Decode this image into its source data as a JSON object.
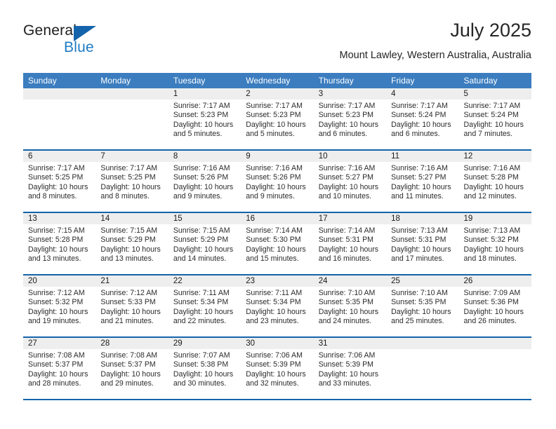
{
  "brand": {
    "name_part1": "General",
    "name_part2": "Blue",
    "logo_icon": "triangle-flag-icon"
  },
  "header": {
    "month_title": "July 2025",
    "location": "Mount Lawley, Western Australia, Australia"
  },
  "colors": {
    "header_blue": "#3b7dbf",
    "rule_blue": "#1464ab",
    "brand_blue": "#1f7bc4",
    "daynum_band": "#eeeeee"
  },
  "weekdays": [
    "Sunday",
    "Monday",
    "Tuesday",
    "Wednesday",
    "Thursday",
    "Friday",
    "Saturday"
  ],
  "weeks": [
    [
      {
        "day": "",
        "sunrise": "",
        "sunset": "",
        "daylight": "",
        "empty": true
      },
      {
        "day": "",
        "sunrise": "",
        "sunset": "",
        "daylight": "",
        "empty": true
      },
      {
        "day": "1",
        "sunrise": "Sunrise: 7:17 AM",
        "sunset": "Sunset: 5:23 PM",
        "daylight": "Daylight: 10 hours and 5 minutes."
      },
      {
        "day": "2",
        "sunrise": "Sunrise: 7:17 AM",
        "sunset": "Sunset: 5:23 PM",
        "daylight": "Daylight: 10 hours and 5 minutes."
      },
      {
        "day": "3",
        "sunrise": "Sunrise: 7:17 AM",
        "sunset": "Sunset: 5:23 PM",
        "daylight": "Daylight: 10 hours and 6 minutes."
      },
      {
        "day": "4",
        "sunrise": "Sunrise: 7:17 AM",
        "sunset": "Sunset: 5:24 PM",
        "daylight": "Daylight: 10 hours and 6 minutes."
      },
      {
        "day": "5",
        "sunrise": "Sunrise: 7:17 AM",
        "sunset": "Sunset: 5:24 PM",
        "daylight": "Daylight: 10 hours and 7 minutes."
      }
    ],
    [
      {
        "day": "6",
        "sunrise": "Sunrise: 7:17 AM",
        "sunset": "Sunset: 5:25 PM",
        "daylight": "Daylight: 10 hours and 8 minutes."
      },
      {
        "day": "7",
        "sunrise": "Sunrise: 7:17 AM",
        "sunset": "Sunset: 5:25 PM",
        "daylight": "Daylight: 10 hours and 8 minutes."
      },
      {
        "day": "8",
        "sunrise": "Sunrise: 7:16 AM",
        "sunset": "Sunset: 5:26 PM",
        "daylight": "Daylight: 10 hours and 9 minutes."
      },
      {
        "day": "9",
        "sunrise": "Sunrise: 7:16 AM",
        "sunset": "Sunset: 5:26 PM",
        "daylight": "Daylight: 10 hours and 9 minutes."
      },
      {
        "day": "10",
        "sunrise": "Sunrise: 7:16 AM",
        "sunset": "Sunset: 5:27 PM",
        "daylight": "Daylight: 10 hours and 10 minutes."
      },
      {
        "day": "11",
        "sunrise": "Sunrise: 7:16 AM",
        "sunset": "Sunset: 5:27 PM",
        "daylight": "Daylight: 10 hours and 11 minutes."
      },
      {
        "day": "12",
        "sunrise": "Sunrise: 7:16 AM",
        "sunset": "Sunset: 5:28 PM",
        "daylight": "Daylight: 10 hours and 12 minutes."
      }
    ],
    [
      {
        "day": "13",
        "sunrise": "Sunrise: 7:15 AM",
        "sunset": "Sunset: 5:28 PM",
        "daylight": "Daylight: 10 hours and 13 minutes."
      },
      {
        "day": "14",
        "sunrise": "Sunrise: 7:15 AM",
        "sunset": "Sunset: 5:29 PM",
        "daylight": "Daylight: 10 hours and 13 minutes."
      },
      {
        "day": "15",
        "sunrise": "Sunrise: 7:15 AM",
        "sunset": "Sunset: 5:29 PM",
        "daylight": "Daylight: 10 hours and 14 minutes."
      },
      {
        "day": "16",
        "sunrise": "Sunrise: 7:14 AM",
        "sunset": "Sunset: 5:30 PM",
        "daylight": "Daylight: 10 hours and 15 minutes."
      },
      {
        "day": "17",
        "sunrise": "Sunrise: 7:14 AM",
        "sunset": "Sunset: 5:31 PM",
        "daylight": "Daylight: 10 hours and 16 minutes."
      },
      {
        "day": "18",
        "sunrise": "Sunrise: 7:13 AM",
        "sunset": "Sunset: 5:31 PM",
        "daylight": "Daylight: 10 hours and 17 minutes."
      },
      {
        "day": "19",
        "sunrise": "Sunrise: 7:13 AM",
        "sunset": "Sunset: 5:32 PM",
        "daylight": "Daylight: 10 hours and 18 minutes."
      }
    ],
    [
      {
        "day": "20",
        "sunrise": "Sunrise: 7:12 AM",
        "sunset": "Sunset: 5:32 PM",
        "daylight": "Daylight: 10 hours and 19 minutes."
      },
      {
        "day": "21",
        "sunrise": "Sunrise: 7:12 AM",
        "sunset": "Sunset: 5:33 PM",
        "daylight": "Daylight: 10 hours and 21 minutes."
      },
      {
        "day": "22",
        "sunrise": "Sunrise: 7:11 AM",
        "sunset": "Sunset: 5:34 PM",
        "daylight": "Daylight: 10 hours and 22 minutes."
      },
      {
        "day": "23",
        "sunrise": "Sunrise: 7:11 AM",
        "sunset": "Sunset: 5:34 PM",
        "daylight": "Daylight: 10 hours and 23 minutes."
      },
      {
        "day": "24",
        "sunrise": "Sunrise: 7:10 AM",
        "sunset": "Sunset: 5:35 PM",
        "daylight": "Daylight: 10 hours and 24 minutes."
      },
      {
        "day": "25",
        "sunrise": "Sunrise: 7:10 AM",
        "sunset": "Sunset: 5:35 PM",
        "daylight": "Daylight: 10 hours and 25 minutes."
      },
      {
        "day": "26",
        "sunrise": "Sunrise: 7:09 AM",
        "sunset": "Sunset: 5:36 PM",
        "daylight": "Daylight: 10 hours and 26 minutes."
      }
    ],
    [
      {
        "day": "27",
        "sunrise": "Sunrise: 7:08 AM",
        "sunset": "Sunset: 5:37 PM",
        "daylight": "Daylight: 10 hours and 28 minutes."
      },
      {
        "day": "28",
        "sunrise": "Sunrise: 7:08 AM",
        "sunset": "Sunset: 5:37 PM",
        "daylight": "Daylight: 10 hours and 29 minutes."
      },
      {
        "day": "29",
        "sunrise": "Sunrise: 7:07 AM",
        "sunset": "Sunset: 5:38 PM",
        "daylight": "Daylight: 10 hours and 30 minutes."
      },
      {
        "day": "30",
        "sunrise": "Sunrise: 7:06 AM",
        "sunset": "Sunset: 5:39 PM",
        "daylight": "Daylight: 10 hours and 32 minutes."
      },
      {
        "day": "31",
        "sunrise": "Sunrise: 7:06 AM",
        "sunset": "Sunset: 5:39 PM",
        "daylight": "Daylight: 10 hours and 33 minutes."
      },
      {
        "day": "",
        "sunrise": "",
        "sunset": "",
        "daylight": "",
        "empty": true
      },
      {
        "day": "",
        "sunrise": "",
        "sunset": "",
        "daylight": "",
        "empty": true
      }
    ]
  ]
}
